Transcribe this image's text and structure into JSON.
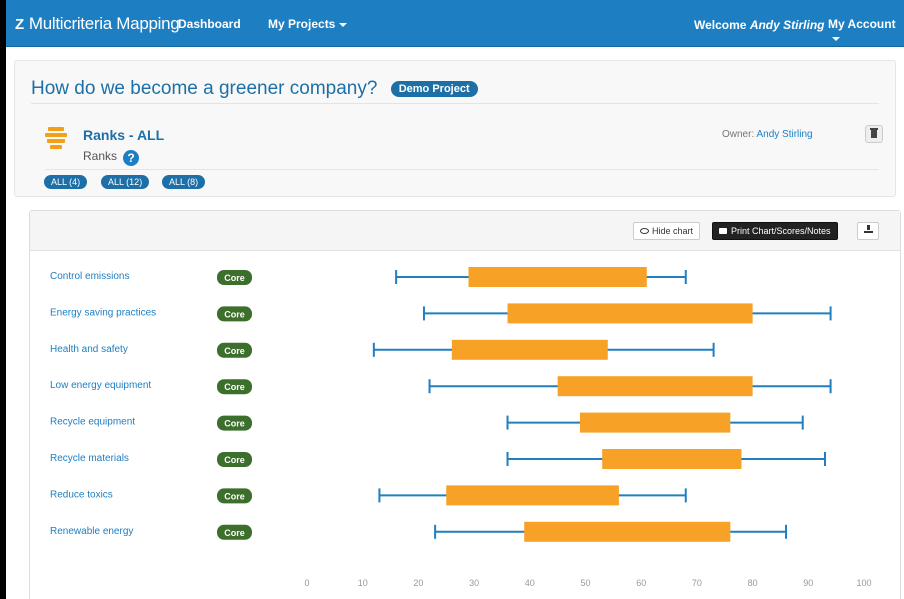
{
  "nav": {
    "brand": "Multicriteria Mapping",
    "dashboard": "Dashboard",
    "my_projects": "My Projects",
    "welcome_prefix": "Welcome",
    "welcome_user": "Andy Stirling",
    "my_account": "My Account"
  },
  "page": {
    "title": "How do we become a greener company?",
    "badge": "Demo Project"
  },
  "ranks": {
    "title": "Ranks - ALL",
    "subtitle": "Ranks",
    "owner_label": "Owner:",
    "owner_name": "Andy Stirling",
    "tags": [
      "ALL (4)",
      "ALL (12)",
      "ALL (8)"
    ]
  },
  "toolbar": {
    "hide_chart": "Hide chart",
    "print": "Print Chart/Scores/Notes"
  },
  "colors": {
    "bar": "#f7a127",
    "whisker": "#1f7fbf",
    "core_badge": "#3c6e2c",
    "link": "#1d7fc2"
  },
  "chart_data": {
    "type": "box-range",
    "badge_label": "Core",
    "xlim": [
      0,
      100
    ],
    "ticks": [
      0,
      10,
      20,
      30,
      40,
      50,
      60,
      70,
      80,
      90,
      100
    ],
    "series": [
      {
        "name": "Control emissions",
        "min": 16,
        "low": 29,
        "high": 61,
        "max": 68
      },
      {
        "name": "Energy saving practices",
        "min": 21,
        "low": 36,
        "high": 80,
        "max": 94
      },
      {
        "name": "Health and safety",
        "min": 12,
        "low": 26,
        "high": 54,
        "max": 73
      },
      {
        "name": "Low energy equipment",
        "min": 22,
        "low": 45,
        "high": 80,
        "max": 94
      },
      {
        "name": "Recycle equipment",
        "min": 36,
        "low": 49,
        "high": 76,
        "max": 89
      },
      {
        "name": "Recycle materials",
        "min": 36,
        "low": 53,
        "high": 78,
        "max": 93
      },
      {
        "name": "Reduce toxics",
        "min": 13,
        "low": 25,
        "high": 56,
        "max": 68
      },
      {
        "name": "Renewable energy",
        "min": 23,
        "low": 39,
        "high": 76,
        "max": 86
      }
    ]
  }
}
